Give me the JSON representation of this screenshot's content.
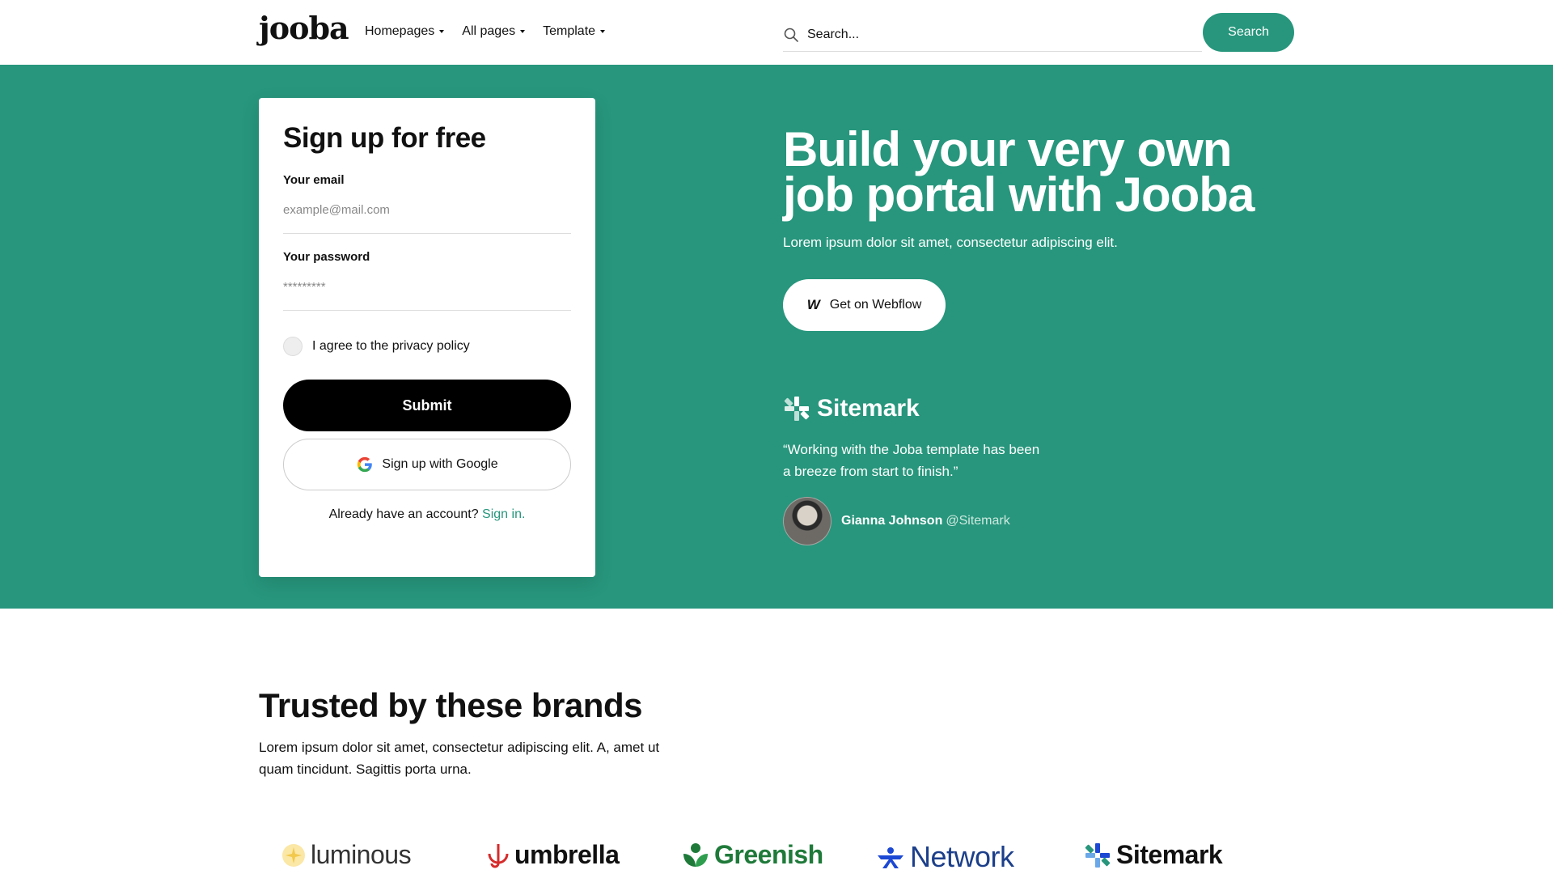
{
  "nav": {
    "logo": "jooba",
    "links": [
      "Homepages",
      "All pages",
      "Template"
    ],
    "search_placeholder": "Search...",
    "search_button": "Search"
  },
  "signup": {
    "title": "Sign up for free",
    "email_label": "Your email",
    "email_placeholder": "example@mail.com",
    "password_label": "Your password",
    "password_placeholder": "*********",
    "agree_text": "I agree to the privacy policy",
    "submit_label": "Submit",
    "google_label": "Sign up with Google",
    "already_text": "Already have an account?",
    "signin_link": "Sign in."
  },
  "hero": {
    "headline_line1": "Build your very own",
    "headline_line2": "job portal with Jooba",
    "subline": "Lorem ipsum dolor sit amet, consectetur adipiscing elit.",
    "cta_label": "Get on Webflow",
    "cta_icon": "W",
    "testimonial_brand": "Sitemark",
    "quote": "“Working with the Joba template has been a breeze from start to finish.”",
    "author_name": "Gianna Johnson",
    "author_handle": "@Sitemark"
  },
  "brands": {
    "title": "Trusted by these brands",
    "description": "Lorem ipsum dolor sit amet, consectetur adipiscing elit. A, amet ut quam tincidunt. Sagittis porta urna.",
    "logos": [
      "luminous",
      "umbrella",
      "Greenish",
      "Network",
      "Sitemark"
    ]
  },
  "colors": {
    "accent": "#27967c",
    "umbrella": "#d62b2b",
    "greenish": "#1f7a3a",
    "network": "#1c48d4",
    "luminous": "#f2c94c"
  }
}
